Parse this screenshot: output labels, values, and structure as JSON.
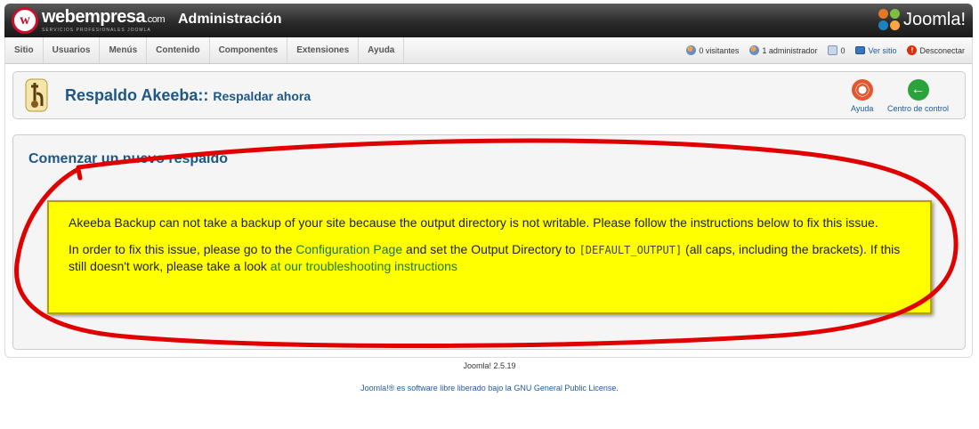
{
  "header": {
    "logo_letter": "w",
    "logo_name": "webempresa",
    "logo_tld": ".com",
    "logo_tagline": "SERVICIOS PROFESIONALES JOOMLA",
    "title": "Administración",
    "brand": "Joomla!"
  },
  "menu": {
    "items": [
      "Sitio",
      "Usuarios",
      "Menús",
      "Contenido",
      "Componentes",
      "Extensiones",
      "Ayuda"
    ]
  },
  "status": {
    "visitors": "0 visitantes",
    "admins": "1 administrador",
    "messages": "0",
    "view_site": "Ver sitio",
    "logout": "Desconectar"
  },
  "toolbar": {
    "title_main": "Respaldo Akeeba::",
    "title_sub": "Respaldar ahora",
    "help_label": "Ayuda",
    "control_center_label": "Centro de control"
  },
  "main": {
    "section_title": "Comenzar un nuevo respaldo",
    "warning_p1": "Akeeba Backup can not take a backup of your site because the output directory is not writable. Please follow the instructions below to fix this issue.",
    "warning_p2_a": "In order to fix this issue, please go to the ",
    "warning_p2_link1": "Configuration Page",
    "warning_p2_b": " and set the Output Directory to ",
    "warning_p2_code": "[DEFAULT_OUTPUT]",
    "warning_p2_c": " (all caps, including the brackets). If this still doesn't work, please take a look ",
    "warning_p2_link2": "at our troubleshooting instructions"
  },
  "footer": {
    "version": "Joomla! 2.5.19",
    "license_a": "Joomla!® es software libre liberado bajo la ",
    "license_link": "GNU General Public License",
    "license_b": "."
  },
  "colors": {
    "header_bg": "#2b2b2b",
    "title_blue": "#1d5787",
    "warning_bg": "#ffff00",
    "annotation_red": "#e00000"
  }
}
